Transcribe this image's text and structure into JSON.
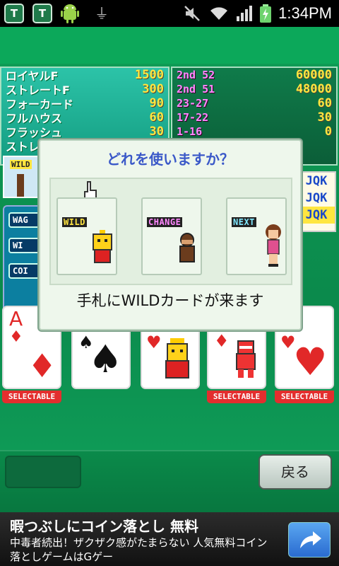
{
  "status_bar": {
    "time": "1:34PM",
    "icons": [
      "shield-t-icon",
      "shield-t-icon",
      "android-icon",
      "usb-icon",
      "mute-icon",
      "wifi-icon",
      "signal-icon",
      "battery-charging-icon"
    ]
  },
  "paytable_left": [
    {
      "name": "ロイヤルF",
      "value": "1500"
    },
    {
      "name": "ストレートF",
      "value": "300"
    },
    {
      "name": "フォーカード",
      "value": "90"
    },
    {
      "name": "フルハウス",
      "value": "60"
    },
    {
      "name": "フラッシュ",
      "value": "30"
    },
    {
      "name": "ストレ",
      "value": ""
    }
  ],
  "paytable_right": [
    {
      "range": "2nd 52",
      "value": "60000"
    },
    {
      "range": "2nd 51",
      "value": "48000"
    },
    {
      "range": "23-27",
      "value": "60"
    },
    {
      "range": "17-22",
      "value": "30"
    },
    {
      "range": "1-16",
      "value": "0"
    }
  ],
  "side_left": {
    "wild_tag": "WILD",
    "chips": [
      "WAG",
      "WI",
      "COI"
    ]
  },
  "side_right": {
    "rows": [
      "JQK",
      "JQK",
      "JQK"
    ]
  },
  "dialog": {
    "title": "どれを使いますか？",
    "options": [
      {
        "label": "WILD",
        "color": "#ffe640"
      },
      {
        "label": "CHANGE",
        "color": "#ff88ff"
      },
      {
        "label": "NEXT",
        "color": "#7fe8ff"
      }
    ],
    "message": "手札にWILDカードが来ます"
  },
  "cards": [
    {
      "rank": "A",
      "suit": "♦",
      "selectable": true
    },
    {
      "rank": "",
      "suit": "♠",
      "selectable": false
    },
    {
      "rank": "",
      "suit": "♥",
      "selectable": false
    },
    {
      "rank": "",
      "suit": "♦",
      "selectable": true
    },
    {
      "rank": "",
      "suit": "♥",
      "selectable": true
    }
  ],
  "selectable_label": "SELECTABLE",
  "bottom_bar": {
    "back_label": "戻る"
  },
  "ad": {
    "title": "暇つぶしにコイン落とし 無料",
    "line1": "中毒者続出！ザクザク感がたまらない 人気無料コイン",
    "line2": "落としゲームはGゲー"
  },
  "colors": {
    "red_suit": "#e12828",
    "black_suit": "#111111",
    "link_blue": "#3a58c8",
    "selectable_red": "#e32e2e"
  }
}
